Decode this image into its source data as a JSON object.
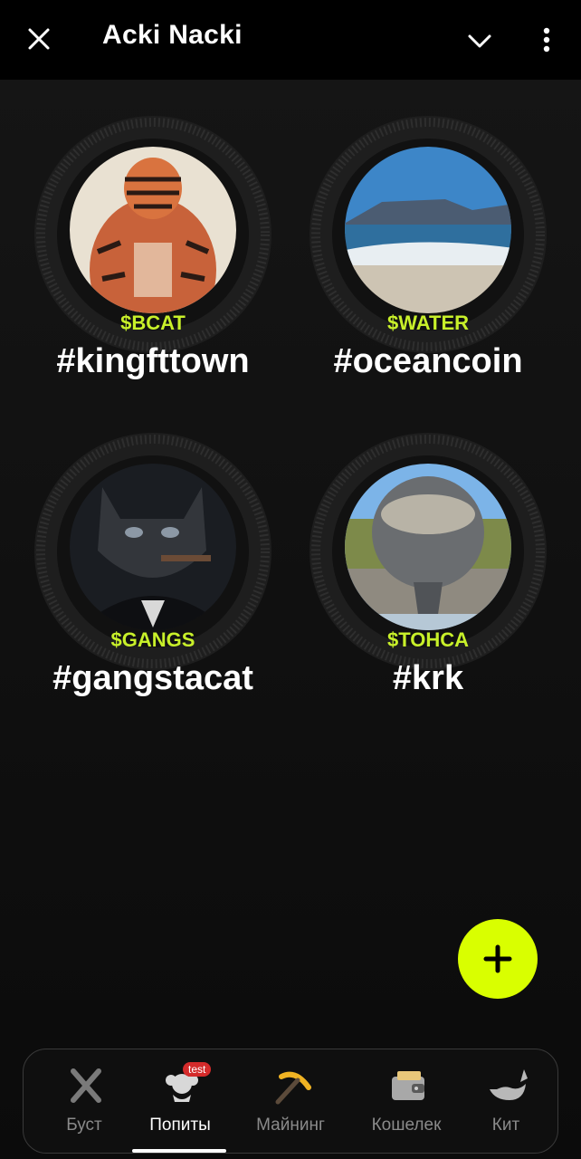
{
  "header": {
    "title": "Acki Nacki"
  },
  "cards": [
    {
      "ticker": "$BCAT",
      "tag": "#kingfttown"
    },
    {
      "ticker": "$WATER",
      "tag": "#oceancoin"
    },
    {
      "ticker": "$GANGS",
      "tag": "#gangstacat"
    },
    {
      "ticker": "$TOHCA",
      "tag": "#krk"
    }
  ],
  "nav": {
    "items": [
      {
        "label": "Буст",
        "icon": "x-logo-icon"
      },
      {
        "label": "Попиты",
        "icon": "popit-icon",
        "badge": "test",
        "active": true
      },
      {
        "label": "Майнинг",
        "icon": "pickaxe-icon"
      },
      {
        "label": "Кошелек",
        "icon": "wallet-icon"
      },
      {
        "label": "Кит",
        "icon": "whale-icon"
      }
    ]
  },
  "colors": {
    "accent": "#d9ff00",
    "ticker": "#c8f02a",
    "badge": "#d42b2b"
  }
}
